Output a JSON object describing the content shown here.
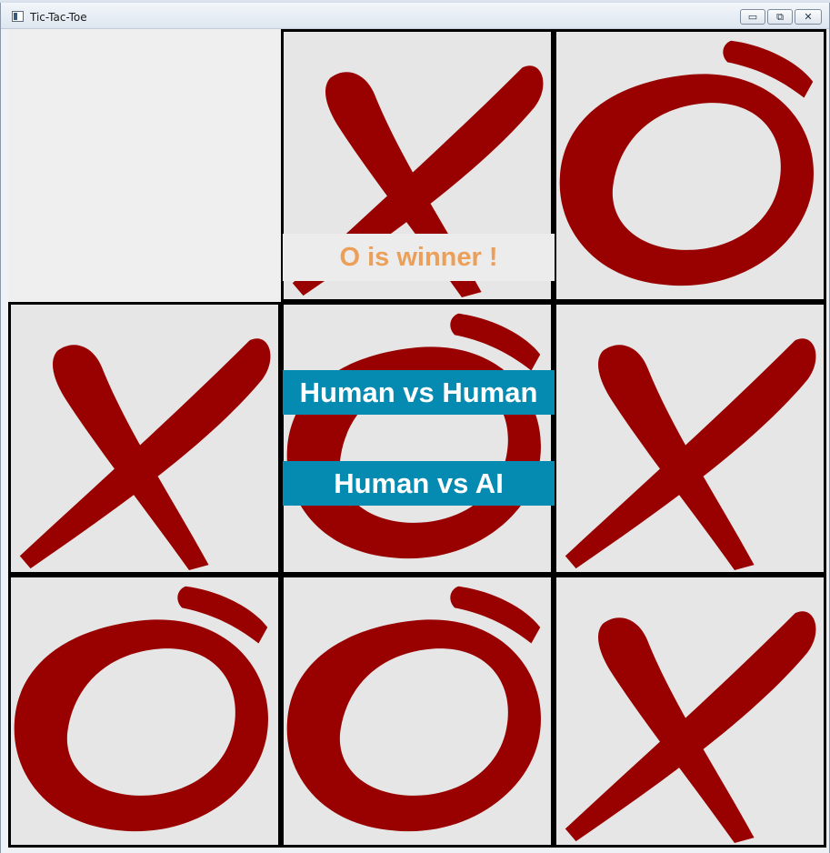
{
  "window": {
    "title": "Tic-Tac-Toe",
    "icon": "app-window-icon",
    "controls": {
      "minimize": "▭",
      "restore": "⧉",
      "close": "✕"
    }
  },
  "board": {
    "cells": [
      "",
      "X",
      "O",
      "X",
      "O",
      "X",
      "O",
      "O",
      "X"
    ],
    "mark_color": "#990000",
    "cell_background": "#e6e6e6",
    "grid_color": "#000000"
  },
  "status": {
    "winner_text": "O is winner !",
    "color": "#eb9f59"
  },
  "menu": {
    "human_vs_human": "Human vs Human",
    "human_vs_ai": "Human vs AI",
    "button_color": "#058ab2"
  }
}
